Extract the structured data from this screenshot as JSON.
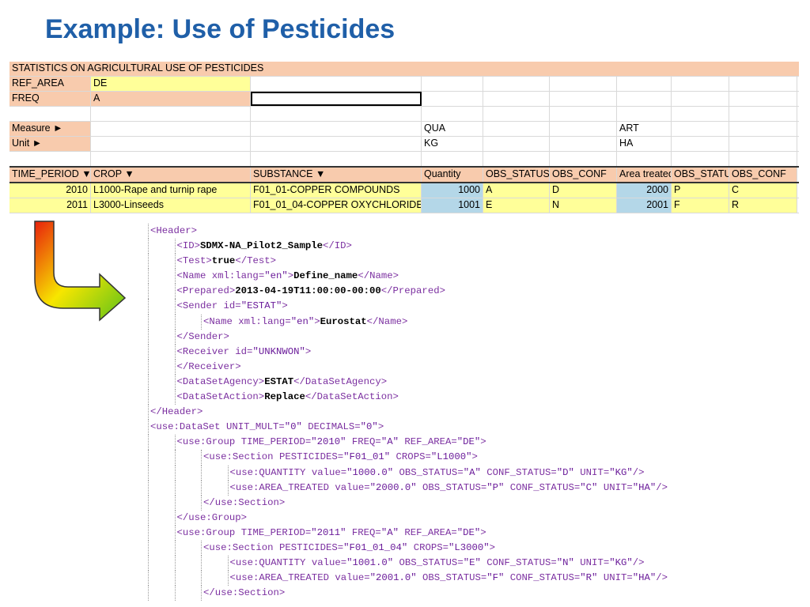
{
  "title": "Example: Use of Pesticides",
  "sheet": {
    "heading": "STATISTICS ON AGRICULTURAL USE OF PESTICIDES",
    "ref_area_label": "REF_AREA",
    "ref_area_value": "DE",
    "freq_label": "FREQ",
    "freq_value": "A",
    "measure_label": "Measure ►",
    "unit_label": "Unit ►",
    "measure_qua": "QUA",
    "measure_art": "ART",
    "unit_kg": "KG",
    "unit_ha": "HA",
    "columns": [
      "TIME_PERIOD ▼",
      "CROP ▼",
      "SUBSTANCE ▼",
      "Quantity",
      "OBS_STATUS",
      "OBS_CONF",
      "Area treated",
      "OBS_STATU",
      "OBS_CONF"
    ],
    "rows": [
      [
        "2010",
        "L1000-Rape and turnip rape",
        "F01_01-COPPER COMPOUNDS",
        "1000",
        "A",
        "D",
        "2000",
        "P",
        "C"
      ],
      [
        "2011",
        "L3000-Linseeds",
        "F01_01_04-COPPER OXYCHLORIDE",
        "1001",
        "E",
        "N",
        "2001",
        "F",
        "R"
      ]
    ]
  },
  "xml": {
    "lines": [
      {
        "indent": 0,
        "parts": [
          [
            "tag",
            "<Header>"
          ]
        ]
      },
      {
        "indent": 1,
        "parts": [
          [
            "tag",
            "<ID>"
          ],
          [
            "txt",
            "SDMX-NA_Pilot2_Sample"
          ],
          [
            "tag",
            "</ID>"
          ]
        ]
      },
      {
        "indent": 1,
        "parts": [
          [
            "tag",
            "<Test>"
          ],
          [
            "txt",
            "true"
          ],
          [
            "tag",
            "</Test>"
          ]
        ]
      },
      {
        "indent": 1,
        "parts": [
          [
            "tag",
            "<Name "
          ],
          [
            "attr",
            "xml:lang="
          ],
          [
            "val",
            "\"en\""
          ],
          [
            "tag",
            ">"
          ],
          [
            "txt",
            "Define_name"
          ],
          [
            "tag",
            "</Name>"
          ]
        ]
      },
      {
        "indent": 1,
        "parts": [
          [
            "tag",
            "<Prepared>"
          ],
          [
            "txt",
            "2013-04-19T11:00:00-00:00"
          ],
          [
            "tag",
            "</Prepared>"
          ]
        ]
      },
      {
        "indent": 1,
        "parts": [
          [
            "tag",
            "<Sender "
          ],
          [
            "attr",
            "id="
          ],
          [
            "val",
            "\"ESTAT\""
          ],
          [
            "tag",
            ">"
          ]
        ]
      },
      {
        "indent": 2,
        "parts": [
          [
            "tag",
            "<Name "
          ],
          [
            "attr",
            "xml:lang="
          ],
          [
            "val",
            "\"en\""
          ],
          [
            "tag",
            ">"
          ],
          [
            "txt",
            "Eurostat"
          ],
          [
            "tag",
            "</Name>"
          ]
        ]
      },
      {
        "indent": 1,
        "parts": [
          [
            "tag",
            "</Sender>"
          ]
        ]
      },
      {
        "indent": 1,
        "parts": [
          [
            "tag",
            "<Receiver "
          ],
          [
            "attr",
            "id="
          ],
          [
            "val",
            "\"UNKNWON\""
          ],
          [
            "tag",
            ">"
          ]
        ]
      },
      {
        "indent": 1,
        "parts": [
          [
            "tag",
            "</Receiver>"
          ]
        ]
      },
      {
        "indent": 1,
        "parts": [
          [
            "tag",
            "<DataSetAgency>"
          ],
          [
            "txt",
            "ESTAT"
          ],
          [
            "tag",
            "</DataSetAgency>"
          ]
        ]
      },
      {
        "indent": 1,
        "parts": [
          [
            "tag",
            "<DataSetAction>"
          ],
          [
            "txt",
            "Replace"
          ],
          [
            "tag",
            "</DataSetAction>"
          ]
        ]
      },
      {
        "indent": 0,
        "parts": [
          [
            "tag",
            "</Header>"
          ]
        ]
      },
      {
        "indent": 0,
        "parts": [
          [
            "tag",
            "<use:DataSet "
          ],
          [
            "attr",
            "UNIT_MULT="
          ],
          [
            "val",
            "\"0\""
          ],
          [
            "attr",
            " DECIMALS="
          ],
          [
            "val",
            "\"0\""
          ],
          [
            "tag",
            ">"
          ]
        ]
      },
      {
        "indent": 1,
        "parts": [
          [
            "tag",
            "<use:Group "
          ],
          [
            "attr",
            "TIME_PERIOD="
          ],
          [
            "val",
            "\"2010\""
          ],
          [
            "attr",
            " FREQ="
          ],
          [
            "val",
            "\"A\""
          ],
          [
            "attr",
            " REF_AREA="
          ],
          [
            "val",
            "\"DE\""
          ],
          [
            "tag",
            ">"
          ]
        ]
      },
      {
        "indent": 2,
        "parts": [
          [
            "tag",
            "<use:Section "
          ],
          [
            "attr",
            "PESTICIDES="
          ],
          [
            "val",
            "\"F01_01\""
          ],
          [
            "attr",
            " CROPS="
          ],
          [
            "val",
            "\"L1000\""
          ],
          [
            "tag",
            ">"
          ]
        ]
      },
      {
        "indent": 3,
        "parts": [
          [
            "tag",
            "<use:QUANTITY "
          ],
          [
            "attr",
            "value="
          ],
          [
            "val",
            "\"1000.0\""
          ],
          [
            "attr",
            " OBS_STATUS="
          ],
          [
            "val",
            "\"A\""
          ],
          [
            "attr",
            " CONF_STATUS="
          ],
          [
            "val",
            "\"D\""
          ],
          [
            "attr",
            " UNIT="
          ],
          [
            "val",
            "\"KG\""
          ],
          [
            "tag",
            "/>"
          ]
        ]
      },
      {
        "indent": 3,
        "parts": [
          [
            "tag",
            "<use:AREA_TREATED "
          ],
          [
            "attr",
            "value="
          ],
          [
            "val",
            "\"2000.0\""
          ],
          [
            "attr",
            " OBS_STATUS="
          ],
          [
            "val",
            "\"P\""
          ],
          [
            "attr",
            " CONF_STATUS="
          ],
          [
            "val",
            "\"C\""
          ],
          [
            "attr",
            " UNIT="
          ],
          [
            "val",
            "\"HA\""
          ],
          [
            "tag",
            "/>"
          ]
        ]
      },
      {
        "indent": 2,
        "parts": [
          [
            "tag",
            "</use:Section>"
          ]
        ]
      },
      {
        "indent": 1,
        "parts": [
          [
            "tag",
            "</use:Group>"
          ]
        ]
      },
      {
        "indent": 1,
        "parts": [
          [
            "tag",
            "<use:Group "
          ],
          [
            "attr",
            "TIME_PERIOD="
          ],
          [
            "val",
            "\"2011\""
          ],
          [
            "attr",
            " FREQ="
          ],
          [
            "val",
            "\"A\""
          ],
          [
            "attr",
            " REF_AREA="
          ],
          [
            "val",
            "\"DE\""
          ],
          [
            "tag",
            ">"
          ]
        ]
      },
      {
        "indent": 2,
        "parts": [
          [
            "tag",
            "<use:Section "
          ],
          [
            "attr",
            "PESTICIDES="
          ],
          [
            "val",
            "\"F01_01_04\""
          ],
          [
            "attr",
            " CROPS="
          ],
          [
            "val",
            "\"L3000\""
          ],
          [
            "tag",
            ">"
          ]
        ]
      },
      {
        "indent": 3,
        "parts": [
          [
            "tag",
            "<use:QUANTITY "
          ],
          [
            "attr",
            "value="
          ],
          [
            "val",
            "\"1001.0\""
          ],
          [
            "attr",
            " OBS_STATUS="
          ],
          [
            "val",
            "\"E\""
          ],
          [
            "attr",
            " CONF_STATUS="
          ],
          [
            "val",
            "\"N\""
          ],
          [
            "attr",
            " UNIT="
          ],
          [
            "val",
            "\"KG\""
          ],
          [
            "tag",
            "/>"
          ]
        ]
      },
      {
        "indent": 3,
        "parts": [
          [
            "tag",
            "<use:AREA_TREATED "
          ],
          [
            "attr",
            "value="
          ],
          [
            "val",
            "\"2001.0\""
          ],
          [
            "attr",
            " OBS_STATUS="
          ],
          [
            "val",
            "\"F\""
          ],
          [
            "attr",
            " CONF_STATUS="
          ],
          [
            "val",
            "\"R\""
          ],
          [
            "attr",
            " UNIT="
          ],
          [
            "val",
            "\"HA\""
          ],
          [
            "tag",
            "/>"
          ]
        ]
      },
      {
        "indent": 2,
        "parts": [
          [
            "tag",
            "</use:Section>"
          ]
        ]
      }
    ]
  },
  "arrow_icon": "curved-arrow-icon"
}
